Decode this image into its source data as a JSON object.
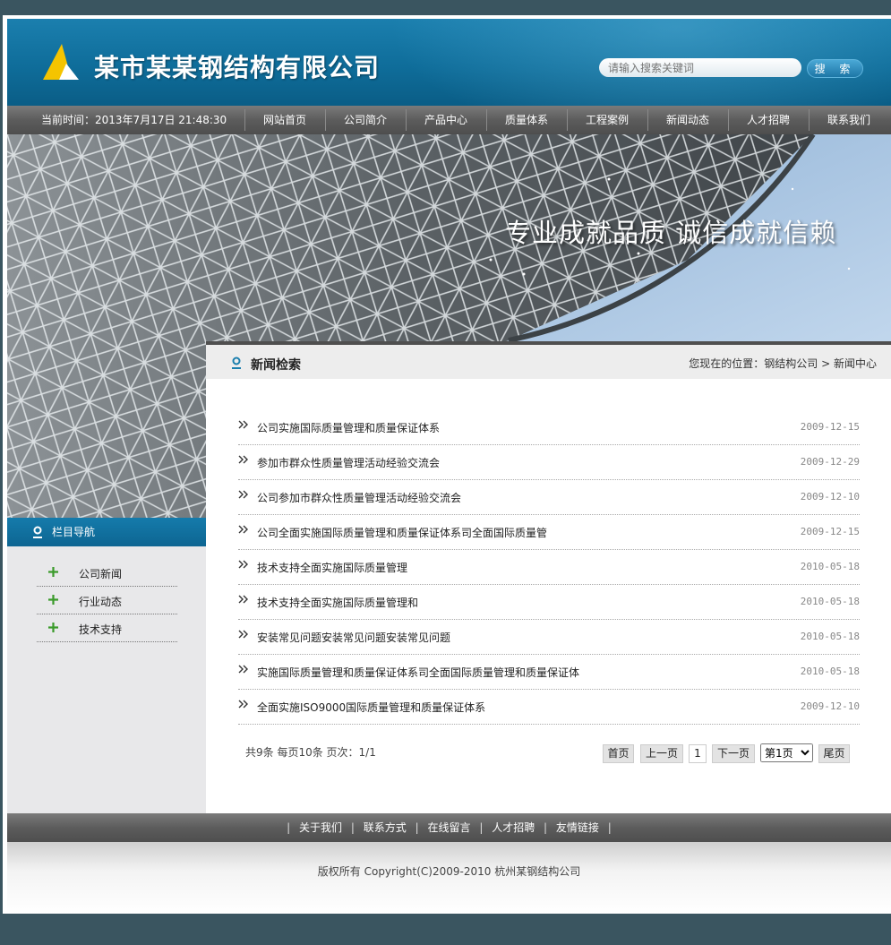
{
  "header": {
    "company_name": "某市某某钢结构有限公司",
    "search_placeholder": "请输入搜索关键词",
    "search_button": "搜 索",
    "brand_yellow": "#f5c400",
    "brand_blue": "#0f6d9a"
  },
  "nav": {
    "time_label": "当前时间：",
    "time_value": "2013年7月17日 21:48:30",
    "items": [
      "网站首页",
      "公司简介",
      "产品中心",
      "质量体系",
      "工程案例",
      "新闻动态",
      "人才招聘",
      "联系我们"
    ]
  },
  "banner": {
    "slogan": "专业成就品质 诚信成就信赖"
  },
  "sidebar": {
    "title": "栏目导航",
    "items": [
      "公司新闻",
      "行业动态",
      "技术支持"
    ]
  },
  "content": {
    "title": "新闻检索",
    "breadcrumb_prefix": "您现在的位置：",
    "breadcrumb_home": "钢结构公司",
    "breadcrumb_sep": " > ",
    "breadcrumb_current": "新闻中心",
    "news": [
      {
        "title": "公司实施国际质量管理和质量保证体系",
        "date": "2009-12-15"
      },
      {
        "title": "参加市群众性质量管理活动经验交流会",
        "date": "2009-12-29"
      },
      {
        "title": "公司参加市群众性质量管理活动经验交流会",
        "date": "2009-12-10"
      },
      {
        "title": "公司全面实施国际质量管理和质量保证体系司全面国际质量管",
        "date": "2009-12-15"
      },
      {
        "title": "技术支持全面实施国际质量管理",
        "date": "2010-05-18"
      },
      {
        "title": "技术支持全面实施国际质量管理和",
        "date": "2010-05-18"
      },
      {
        "title": "安装常见问题安装常见问题安装常见问题",
        "date": "2010-05-18"
      },
      {
        "title": "实施国际质量管理和质量保证体系司全面国际质量管理和质量保证体",
        "date": "2010-05-18"
      },
      {
        "title": "全面实施ISO9000国际质量管理和质量保证体系",
        "date": "2009-12-10"
      }
    ],
    "pager": {
      "info": "共9条  每页10条  页次：1/1",
      "first": "首页",
      "prev": "上一页",
      "current": "1",
      "next": "下一页",
      "select_value": "第1页",
      "last": "尾页"
    }
  },
  "footer": {
    "links": [
      "关于我们",
      "联系方式",
      "在线留言",
      "人才招聘",
      "友情链接"
    ],
    "copyright": "版权所有  Copyright(C)2009-2010 杭州某钢结构公司"
  }
}
